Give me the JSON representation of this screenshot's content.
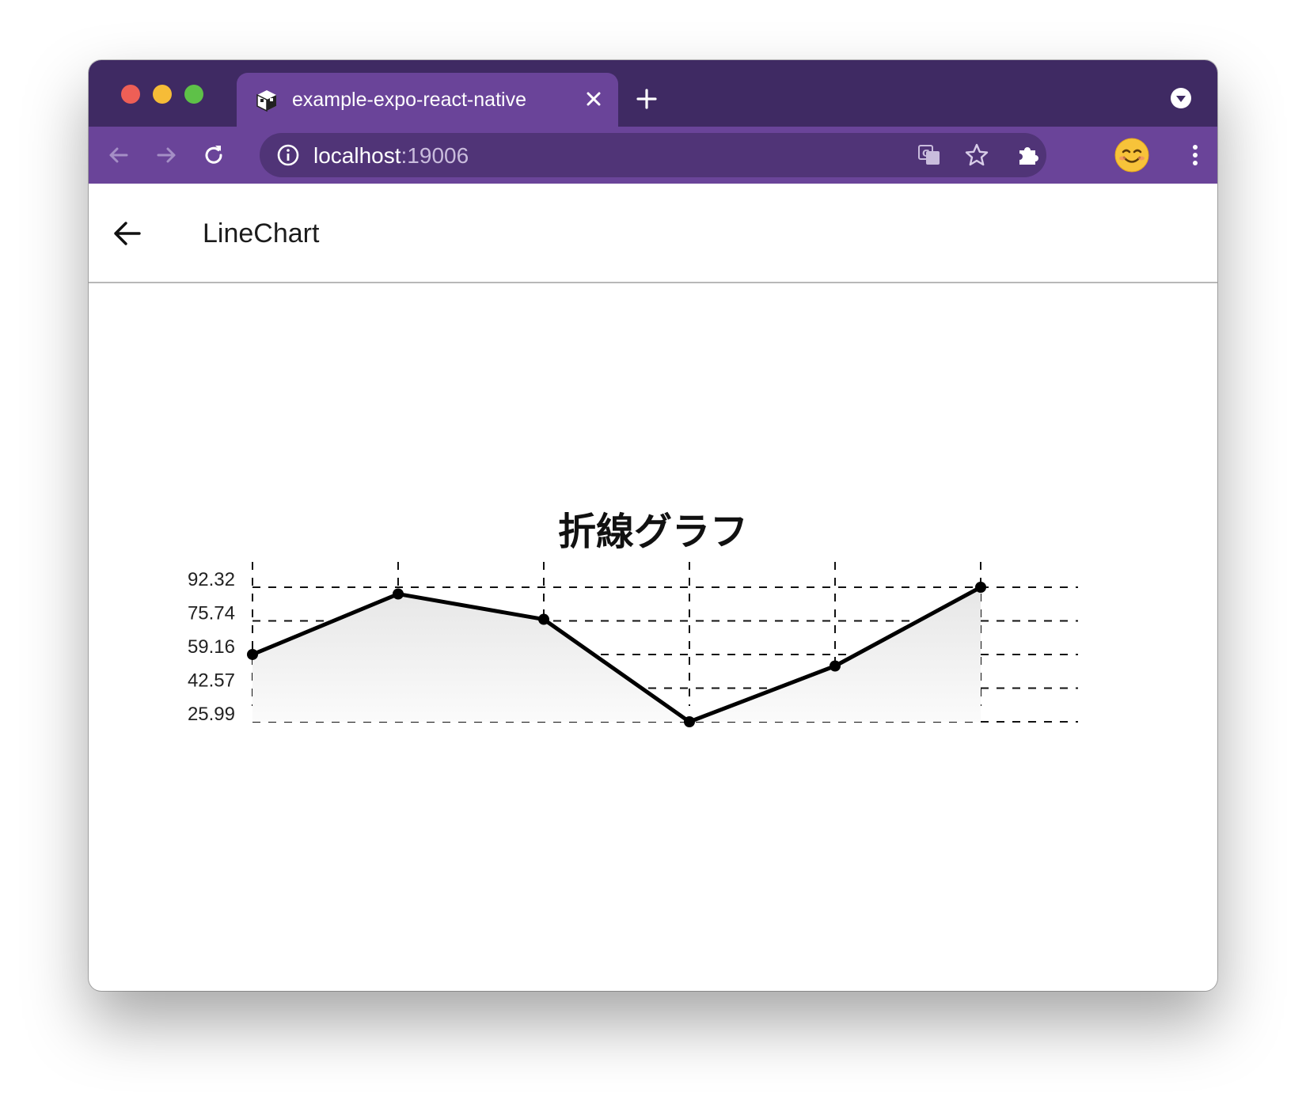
{
  "browser": {
    "tab_title": "example-expo-react-native",
    "url_host": "localhost",
    "url_port": ":19006",
    "accent_color": "#6a4499",
    "frame_color": "#3f2a63"
  },
  "app": {
    "header_title": "LineChart"
  },
  "chart_data": {
    "type": "area",
    "title": "折線グラフ",
    "xlabel": "",
    "ylabel": "",
    "x": [
      0,
      1,
      2,
      3,
      4,
      5
    ],
    "values": [
      59.16,
      89.0,
      76.5,
      25.99,
      53.5,
      92.32
    ],
    "y_ticks": [
      "25.99",
      "42.57",
      "59.16",
      "75.74",
      "92.32"
    ],
    "ylim": [
      25.99,
      92.32
    ],
    "grid": "dashed",
    "line_color": "#000000",
    "fill": "gradient-grey"
  }
}
